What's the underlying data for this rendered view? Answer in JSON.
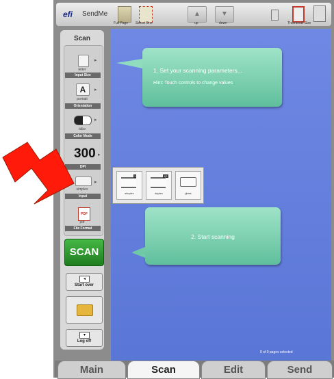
{
  "topbar": {
    "logo": "efi",
    "app_name": "SendMe",
    "full_page_label": "Full Page",
    "select_one_label": "Select One",
    "up_label": "up",
    "down_label": "down",
    "thumbnail_size_label": "Thumbnail Size"
  },
  "sidebar": {
    "title": "Scan",
    "params": [
      {
        "value": "letter",
        "label": "Input Size"
      },
      {
        "value": "portrait",
        "label": "Orientation"
      },
      {
        "value": "b&w",
        "label": "Color Mode"
      },
      {
        "value": "300",
        "label": "DPI"
      },
      {
        "value": "simplex",
        "label": "Input"
      },
      {
        "value": "pdf",
        "label": "File Format"
      }
    ],
    "orientation_glyph": "A",
    "scan_button": "SCAN",
    "start_over": "Start over",
    "log_off": "Log off"
  },
  "main": {
    "callout1_title": "1. Set your scanning parameters...",
    "callout1_hint": "Hint: Touch controls to change values",
    "callout2_text": "2. Start scanning",
    "input_options": [
      {
        "label": "simplex",
        "badge": "1"
      },
      {
        "label": "duplex",
        "badge": "1|2"
      },
      {
        "label": "glass",
        "badge": ""
      }
    ],
    "page_count": "0 of 0 pages selected"
  },
  "tabs": [
    "Main",
    "Scan",
    "Edit",
    "Send"
  ],
  "active_tab": "Scan",
  "colors": {
    "main_background": "#5f7bdb",
    "callout": "#7fd3b2",
    "scan_button": "#2e9a2e",
    "arrow": "#ff1a0a"
  }
}
